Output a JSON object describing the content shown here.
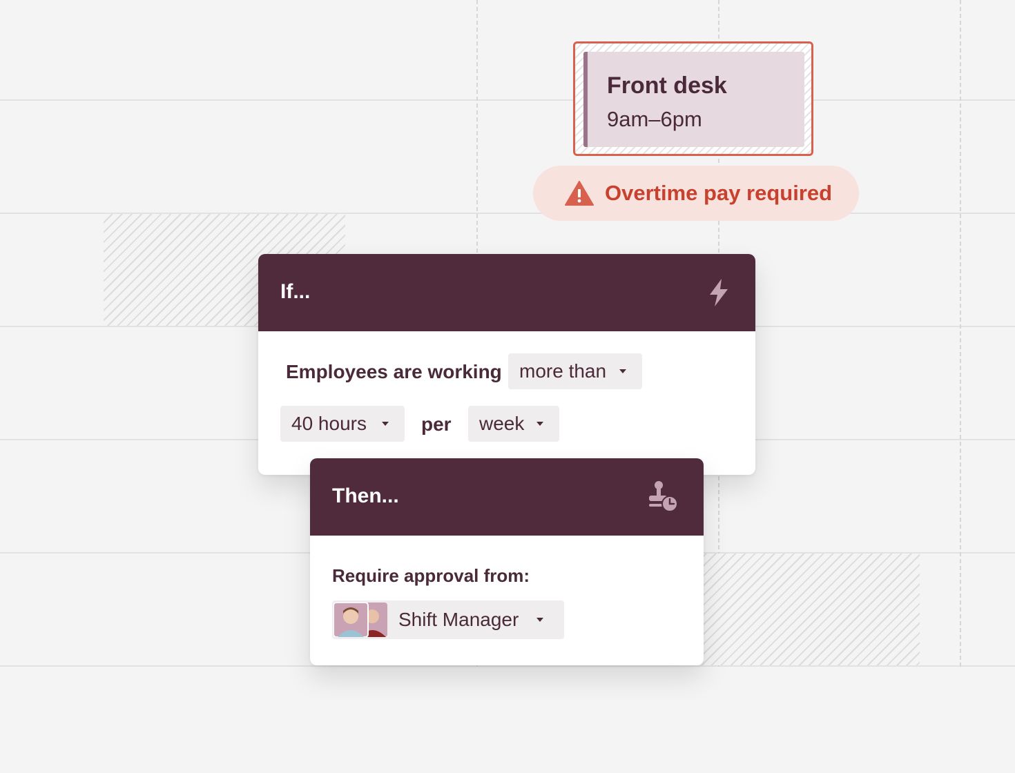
{
  "shift": {
    "title": "Front desk",
    "time": "9am–6pm"
  },
  "warning": {
    "icon": "warning-triangle-icon",
    "text": "Overtime pay required",
    "color": "#c8412e"
  },
  "if_card": {
    "title": "If...",
    "icon": "lightning-icon",
    "condition_label": "Employees are working",
    "comparison": "more than",
    "amount": "40 hours",
    "per_label": "per",
    "period": "week"
  },
  "then_card": {
    "title": "Then...",
    "icon": "approval-stamp-clock-icon",
    "approval_label": "Require approval from:",
    "approver": "Shift Manager"
  },
  "colors": {
    "header": "#4f2b3c",
    "accent_red": "#d7604e",
    "shift_fill": "#e6d9df"
  }
}
